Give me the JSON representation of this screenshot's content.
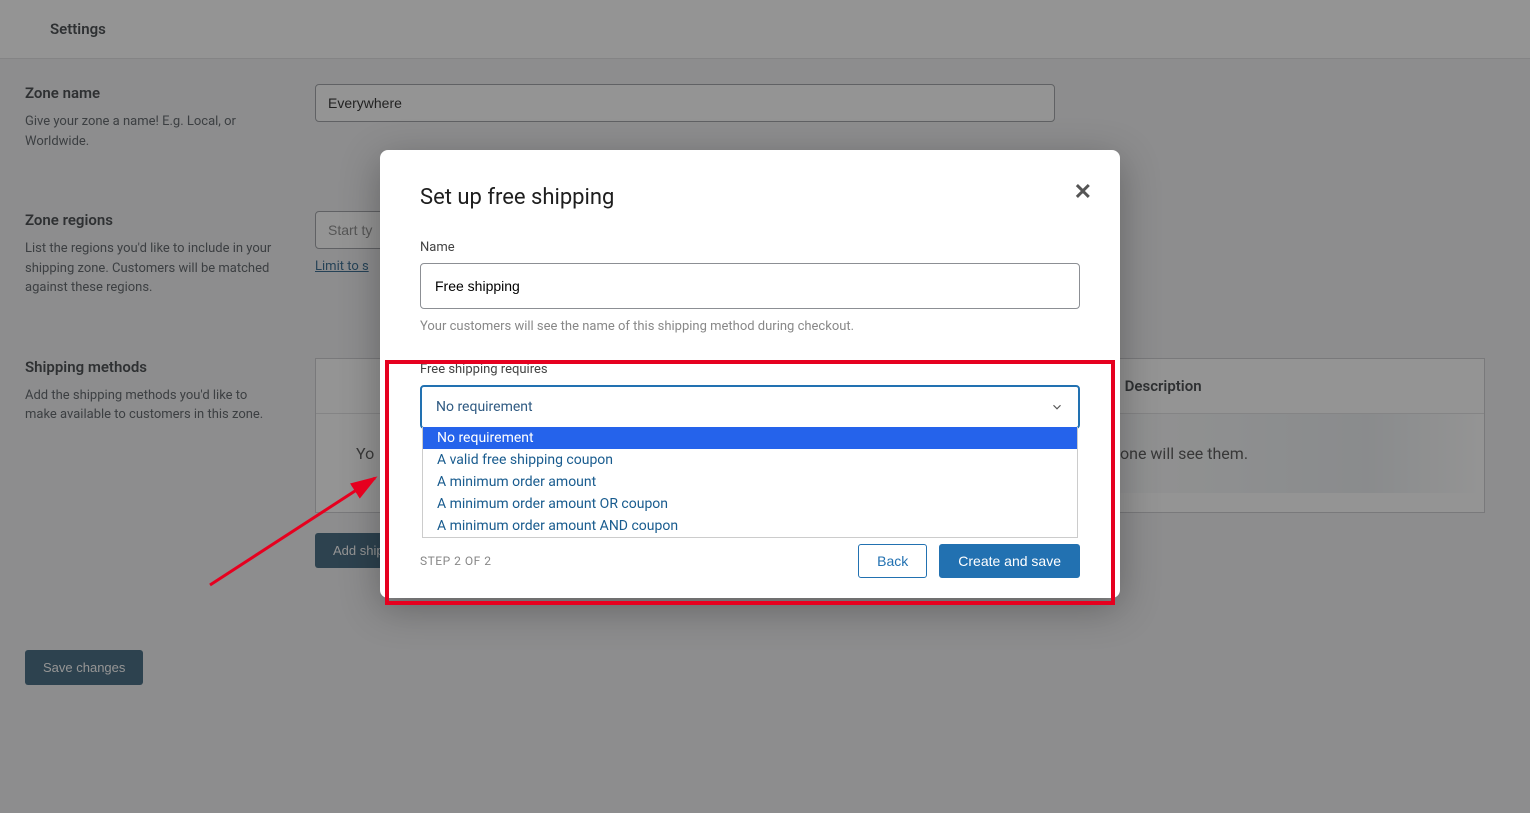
{
  "header": {
    "title": "Settings"
  },
  "zone_name": {
    "label": "Zone name",
    "help": "Give your zone a name! E.g. Local, or Worldwide.",
    "value": "Everywhere"
  },
  "zone_regions": {
    "label": "Zone regions",
    "help": "List the regions you'd like to include in your shipping zone. Customers will be matched against these regions.",
    "placeholder": "Start ty",
    "limit_link": "Limit to s"
  },
  "shipping_methods": {
    "label": "Shipping methods",
    "help": "Add the shipping methods you'd like to make available to customers in this zone.",
    "col_description": "Description",
    "empty_text_left": "Yo",
    "empty_text_right": "zone will see them.",
    "add_button": "Add shipping method"
  },
  "save_button": "Save changes",
  "modal": {
    "title": "Set up free shipping",
    "name_label": "Name",
    "name_value": "Free shipping",
    "name_hint": "Your customers will see the name of this shipping method during checkout.",
    "requires_label": "Free shipping requires",
    "select_value": "No requirement",
    "options": [
      "No requirement",
      "A valid free shipping coupon",
      "A minimum order amount",
      "A minimum order amount OR coupon",
      "A minimum order amount AND coupon"
    ],
    "step": "STEP 2 OF 2",
    "back": "Back",
    "create": "Create and save"
  }
}
